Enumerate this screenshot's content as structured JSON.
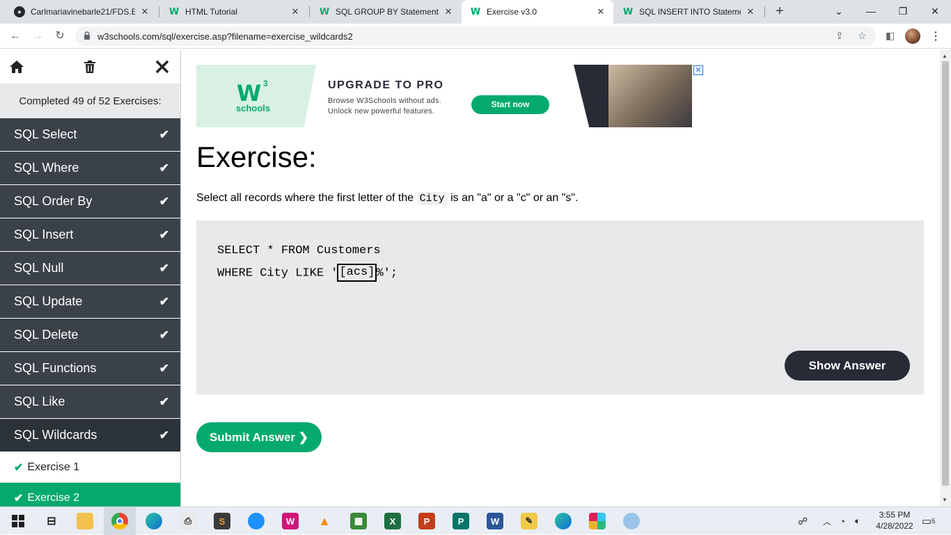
{
  "browser": {
    "tabs": [
      {
        "title": "Carlmariavinebarle21/FDS.EB",
        "icon": "github-icon"
      },
      {
        "title": "HTML Tutorial",
        "icon": "w3schools-icon"
      },
      {
        "title": "SQL GROUP BY Statement",
        "icon": "w3schools-icon"
      },
      {
        "title": "Exercise v3.0",
        "icon": "w3schools-icon",
        "active": true
      },
      {
        "title": "SQL INSERT INTO Statement",
        "icon": "w3schools-icon"
      }
    ],
    "url": "w3schools.com/sql/exercise.asp?filename=exercise_wildcards2"
  },
  "sidebar": {
    "completed_text": "Completed 49 of 52 Exercises:",
    "items": [
      {
        "label": "SQL Select"
      },
      {
        "label": "SQL Where"
      },
      {
        "label": "SQL Order By"
      },
      {
        "label": "SQL Insert"
      },
      {
        "label": "SQL Null"
      },
      {
        "label": "SQL Update"
      },
      {
        "label": "SQL Delete"
      },
      {
        "label": "SQL Functions"
      },
      {
        "label": "SQL Like"
      },
      {
        "label": "SQL Wildcards"
      }
    ],
    "sub_items": [
      {
        "label": "Exercise 1"
      },
      {
        "label": "Exercise 2"
      }
    ]
  },
  "ad": {
    "logo_text": "W",
    "logo_sup": "3",
    "logo_sub": "schools",
    "headline": "UPGRADE TO PRO",
    "line1": "Browse W3Schools without ads.",
    "line2": "Unlock new powerful features.",
    "cta": "Start now"
  },
  "exercise": {
    "title": "Exercise:",
    "desc_before": "Select all records where the first letter of the",
    "desc_code": "City",
    "desc_after": "is an \"a\" or a \"c\" or an \"s\".",
    "code_line1": "SELECT * FROM Customers",
    "code_line2_before": "WHERE City LIKE '",
    "answer_value": "[acs]",
    "code_line2_after": "%';",
    "show_answer": "Show Answer",
    "submit": "Submit Answer ❯"
  },
  "taskbar": {
    "time": "3:55 PM",
    "date": "4/28/2022",
    "notification_count": "5"
  },
  "colors": {
    "accent": "#04aa6d",
    "sidebar_bg": "#3a4148",
    "dark_button": "#282a35"
  }
}
